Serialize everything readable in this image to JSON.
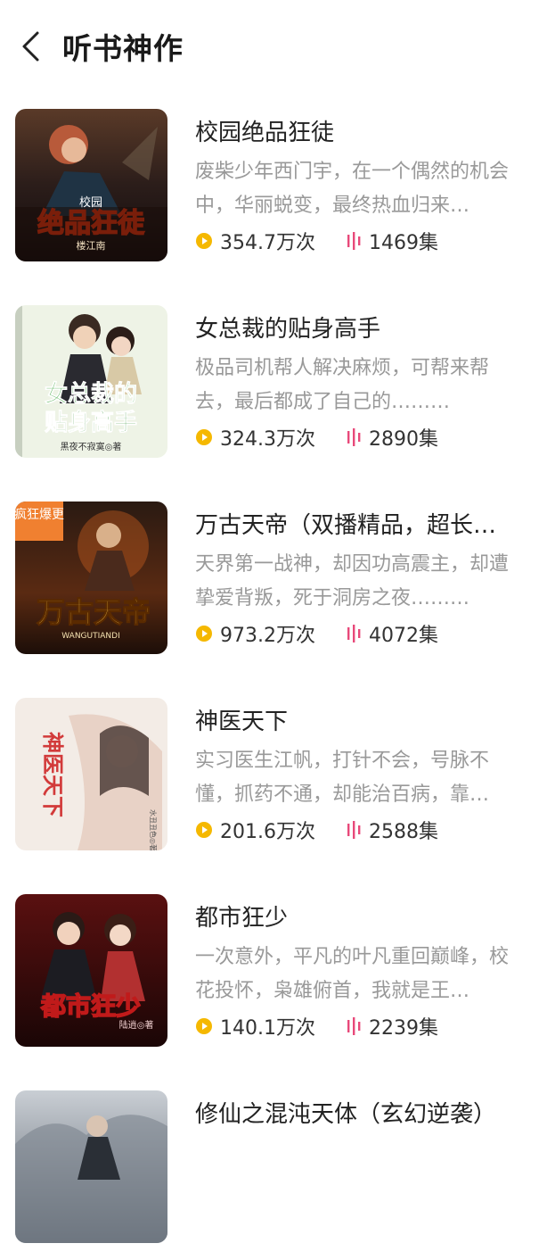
{
  "header": {
    "title": "听书神作"
  },
  "colors": {
    "play": "#F5B800",
    "episodes": "#E8497A"
  },
  "books": [
    {
      "title": "校园绝品狂徒",
      "description": "废柴少年西门宇，在一个偶然的机会中，华丽蜕变，最终热血归来…",
      "plays": "354.7万次",
      "episodes": "1469集",
      "cover": {
        "main": "绝品狂徒",
        "top": "校园",
        "author": "楼江南"
      }
    },
    {
      "title": "女总裁的贴身高手",
      "description": "极品司机帮人解决麻烦，可帮来帮去，最后都成了自己的………",
      "plays": "324.3万次",
      "episodes": "2890集",
      "cover": {
        "main": "女总裁的",
        "sub": "贴身高手",
        "author": "黑夜不寂寞◎著"
      }
    },
    {
      "title": "万古天帝（双播精品，超长…",
      "description": "天界第一战神，却因功高震主，却遭挚爱背叛，死于洞房之夜………",
      "plays": "973.2万次",
      "episodes": "4072集",
      "cover": {
        "badge": "疯狂爆更",
        "main": "万古天帝",
        "sub": "WANGUTIANDI"
      }
    },
    {
      "title": "神医天下",
      "description": "实习医生江帆，打针不会，号脉不懂，抓药不通，却能治百病，靠…",
      "plays": "201.6万次",
      "episodes": "2588集",
      "cover": {
        "main": "神医天下",
        "sub": "水丑丑色◎著"
      }
    },
    {
      "title": "都市狂少",
      "description": "一次意外，平凡的叶凡重回巅峰，校花投怀，枭雄俯首，我就是王…",
      "plays": "140.1万次",
      "episodes": "2239集",
      "cover": {
        "main": "都市狂少",
        "author": "陆逍◎著"
      }
    },
    {
      "title": "修仙之混沌天体（玄幻逆袭）",
      "description": "",
      "plays": "",
      "episodes": "",
      "cover": {}
    }
  ]
}
